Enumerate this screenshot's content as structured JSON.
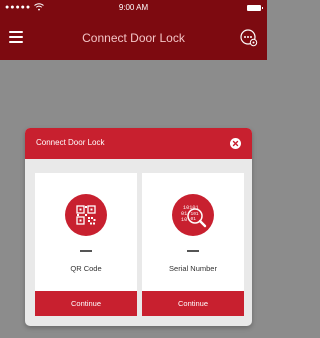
{
  "status_bar": {
    "time": "9:00 AM"
  },
  "nav": {
    "title": "Connect Door Lock",
    "menu_icon": "hamburger-menu-icon",
    "settings_icon": "settings-icon"
  },
  "modal": {
    "title": "Connect Door Lock",
    "close_icon": "close-icon",
    "options": [
      {
        "label": "QR Code",
        "icon": "qr-code-icon",
        "button": "Continue"
      },
      {
        "label": "Serial Number",
        "icon": "serial-number-search-icon",
        "button": "Continue"
      }
    ]
  },
  "colors": {
    "primary": "#c8202f",
    "header_dark": "#7d0a10",
    "overlay": "#8c8c8c"
  }
}
